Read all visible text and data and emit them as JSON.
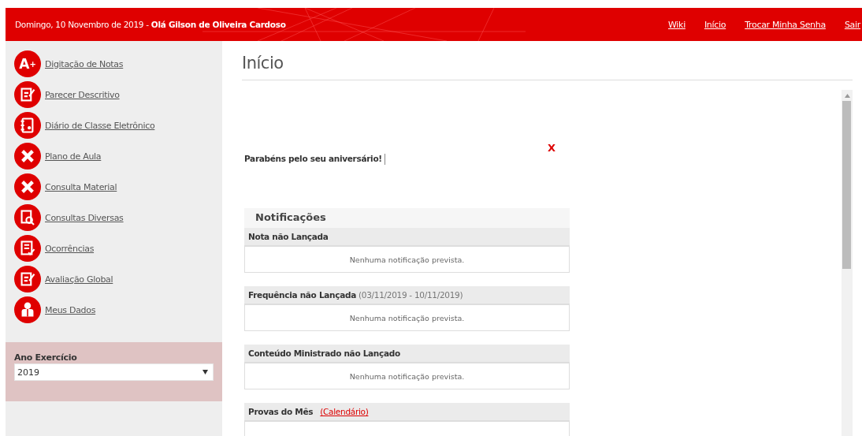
{
  "header": {
    "greeting": "Domingo, 10 Novembro de 2019 - **Olá Gilson de Oliveira Cardoso**",
    "links": [
      "Wiki",
      "Início",
      "Trocar Minha Senha",
      "Sair"
    ]
  },
  "sidebar": {
    "items": [
      {
        "label": "Digitação de Notas",
        "icon_text": "A$^{+}$"
      },
      {
        "label": "Parecer Descritivo"
      },
      {
        "label": "Diário de Classe Eletrônico"
      },
      {
        "label": "Plano de Aula"
      },
      {
        "label": "Consulta Material"
      },
      {
        "label": "Consultas Diversas"
      },
      {
        "label": "Ocorrências"
      },
      {
        "label": "Avaliação Global"
      },
      {
        "label": "Meus Dados"
      }
    ],
    "year_panel": {
      "label": "Ano Exercício",
      "value": "2019"
    }
  },
  "page": {
    "title": "Início",
    "birthday": {
      "message": "Parabéns pelo seu aniversário!",
      "close": "X"
    },
    "notifications": {
      "title": "Notificações",
      "sections": [
        {
          "title": "Nota não Lançada",
          "body": "Nenhuma notificação prevista."
        },
        {
          "title": "Frequência não Lançada",
          "subtitle": "(03/11/2019 - 10/11/2019)",
          "body": "Nenhuma notificação prevista."
        },
        {
          "title": "Conteúdo Ministrado não Lançado",
          "body": "Nenhuma notificação prevista."
        },
        {
          "title": "Provas do Mês",
          "link": "(Calendário)"
        }
      ]
    }
  }
}
